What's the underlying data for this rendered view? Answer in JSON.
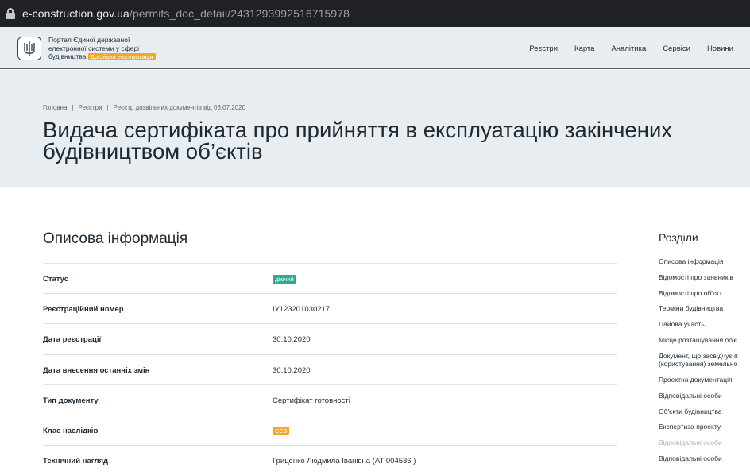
{
  "browser": {
    "url_host": "e-construction.gov.ua",
    "url_path": "/permits_doc_detail/2431293992516715978"
  },
  "header": {
    "portal_line1": "Портал Єдиної державної",
    "portal_line2": "електронної системи у сфері",
    "portal_line3": "будівництва",
    "trial_badge": "Дослідна експлуатація",
    "nav": [
      "Реєстри",
      "Карта",
      "Аналітика",
      "Сервіси",
      "Новини"
    ]
  },
  "breadcrumb": [
    "Головна",
    "Реєстри",
    "Реєстр дозвільних документів від 06.07.2020"
  ],
  "page_title_line1": "Видача сертифіката про прийняття в експлуатацію закінчених",
  "page_title_line2": "будівництвом об’єктів",
  "section_title": "Описова інформація",
  "fields": [
    {
      "label": "Статус",
      "value": "діючий"
    },
    {
      "label": "Реєстраційний номер",
      "value": "ІУ123201030217"
    },
    {
      "label": "Дата реєстрації",
      "value": "30.10.2020"
    },
    {
      "label": "Дата внесення останніх змін",
      "value": "30.10.2020"
    },
    {
      "label": "Тип документу",
      "value": "Сертифікат готовності"
    },
    {
      "label": "Клас наслідків",
      "value": "СС3"
    },
    {
      "label": "Технічний нагляд",
      "value": "Гриценко Людмила Іванівна (АТ 004536 )"
    }
  ],
  "sidebar": {
    "title": "Розділи",
    "items": [
      {
        "label": "Описова інформація"
      },
      {
        "label": "Відомості про заявників"
      },
      {
        "label": "Відомості про об'єкт"
      },
      {
        "label": "Терміни будівництва"
      },
      {
        "label": "Пайова участь"
      },
      {
        "label": "Місце розташування об'є"
      },
      {
        "label": "Документ, що засвідчує п"
      },
      {
        "label": "(користування) земельно"
      },
      {
        "label": "Проектна документація"
      },
      {
        "label": "Відповідальні особи"
      },
      {
        "label": "Об'єкти будівництва"
      },
      {
        "label": "Експертиза проекту"
      },
      {
        "label": "Відповідальні особи"
      },
      {
        "label": "Відповідальні особи"
      }
    ]
  },
  "colors": {
    "status_active": "#2cab8f",
    "class_badge": "#f0a830",
    "header_bg": "#e8edf1"
  }
}
